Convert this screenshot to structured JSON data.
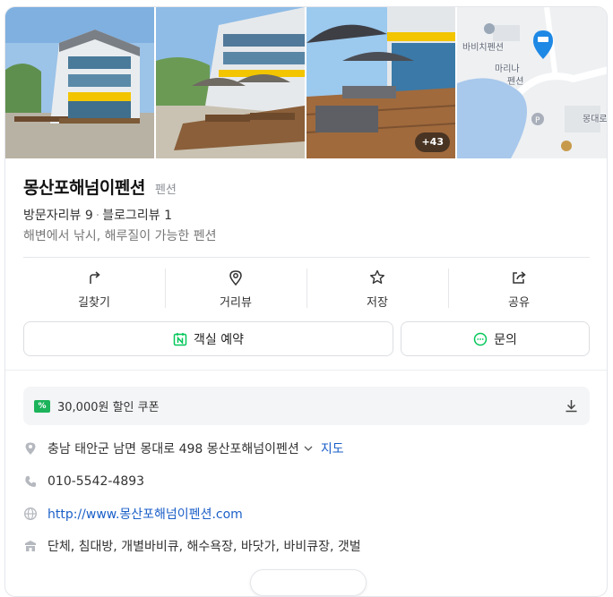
{
  "photos": {
    "more_count": "+43",
    "map_labels": [
      "바비치펜션",
      "마리나",
      "펜션",
      "몽대로"
    ]
  },
  "place": {
    "name": "몽산포해넘이펜션",
    "category": "펜션",
    "visitor_reviews": "방문자리뷰 9",
    "blog_reviews": "블로그리뷰 1",
    "description": "해변에서 낚시, 해루질이 가능한 펜션"
  },
  "actions": [
    {
      "label": "길찾기",
      "icon": "directions-icon"
    },
    {
      "label": "거리뷰",
      "icon": "street-view-icon"
    },
    {
      "label": "저장",
      "icon": "star-icon"
    },
    {
      "label": "공유",
      "icon": "share-icon"
    }
  ],
  "buttons": {
    "reserve": "객실 예약",
    "inquiry": "문의"
  },
  "coupon": {
    "tag": "%",
    "text": "30,000원 할인 쿠폰"
  },
  "info": {
    "address": "충남 태안군 남면 몽대로 498 몽산포해넘이펜션",
    "map_link": "지도",
    "phone": "010-5542-4893",
    "website": "http://www.몽산포해넘이펜션.com",
    "amenities": "단체, 침대방, 개별바비큐, 해수욕장, 바닷가, 바비큐장, 갯벌"
  },
  "colors": {
    "naver_green": "#03c75a",
    "link_blue": "#1b5fc8",
    "map_pin_blue": "#1e88e5",
    "coupon_green": "#1cb35a"
  }
}
